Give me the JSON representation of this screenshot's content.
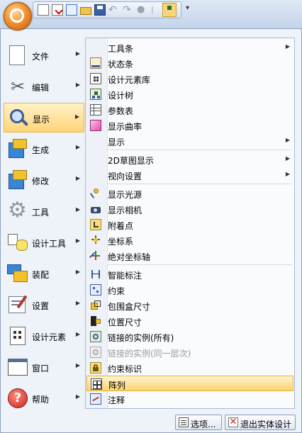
{
  "left_menu": [
    {
      "label": "文件",
      "icon": "file-icon"
    },
    {
      "label": "编辑",
      "icon": "scissors-icon"
    },
    {
      "label": "显示",
      "icon": "magnifier-icon"
    },
    {
      "label": "生成",
      "icon": "cube-create-icon"
    },
    {
      "label": "修改",
      "icon": "cube-modify-icon"
    },
    {
      "label": "工具",
      "icon": "gear-icon"
    },
    {
      "label": "设计工具",
      "icon": "design-tools-icon"
    },
    {
      "label": "装配",
      "icon": "assembly-icon"
    },
    {
      "label": "设置",
      "icon": "settings-icon"
    },
    {
      "label": "设计元素",
      "icon": "design-element-icon"
    },
    {
      "label": "窗口",
      "icon": "window-icon"
    },
    {
      "label": "帮助",
      "icon": "help-icon"
    }
  ],
  "submenu": {
    "items": [
      {
        "label": "工具条"
      },
      {
        "label": "状态条"
      },
      {
        "label": "设计元素库"
      },
      {
        "label": "设计树"
      },
      {
        "label": "参数表"
      },
      {
        "label": "显示曲率"
      },
      {
        "label": "显示"
      },
      {
        "label": "2D草图显示"
      },
      {
        "label": "视向设置"
      },
      {
        "label": "显示光源"
      },
      {
        "label": "显示相机"
      },
      {
        "label": "附着点"
      },
      {
        "label": "坐标系"
      },
      {
        "label": "绝对坐标轴"
      },
      {
        "label": "智能标注"
      },
      {
        "label": "约束"
      },
      {
        "label": "包围盒尺寸"
      },
      {
        "label": "位置尺寸"
      },
      {
        "label": "链接的实例(所有)"
      },
      {
        "label": "链接的实例(同一层次)"
      },
      {
        "label": "约束标识"
      },
      {
        "label": "阵列"
      },
      {
        "label": "注释"
      }
    ]
  },
  "bottom_buttons": {
    "options_label": "选项...",
    "exit_label": "退出实体设计"
  }
}
